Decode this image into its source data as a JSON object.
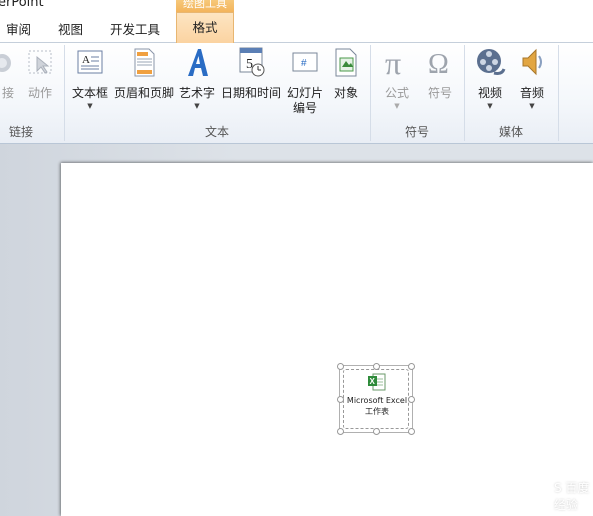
{
  "app": {
    "title_fragment": "erPoint"
  },
  "tabs": [
    {
      "label": "审阅"
    },
    {
      "label": "视图"
    },
    {
      "label": "开发工具"
    }
  ],
  "context_tab": {
    "header": "绘图工具",
    "label": "格式"
  },
  "groups": {
    "links": {
      "label": "链接",
      "buttons": [
        {
          "label": "链接",
          "shown": "接"
        },
        {
          "label": "动作"
        }
      ]
    },
    "text": {
      "label": "文本",
      "buttons": [
        {
          "label": "文本框"
        },
        {
          "label": "页眉和页脚"
        },
        {
          "label": "艺术字"
        },
        {
          "label": "日期和时间"
        },
        {
          "label_line1": "幻灯片",
          "label_line2": "编号"
        },
        {
          "label": "对象"
        }
      ]
    },
    "symbols": {
      "label": "符号",
      "buttons": [
        {
          "label": "公式"
        },
        {
          "label": "符号"
        }
      ]
    },
    "media": {
      "label": "媒体",
      "buttons": [
        {
          "label": "视频"
        },
        {
          "label": "音频"
        }
      ]
    }
  },
  "slide": {
    "embedded_object": {
      "line1": "Microsoft Excel",
      "line2": "工作表"
    }
  },
  "watermark": "S 百度经验",
  "colors": {
    "ribbon_bg": "#f4f7fb",
    "context_tab_orange": "#fbd3a1",
    "workspace_bg": "#dde2e8"
  }
}
